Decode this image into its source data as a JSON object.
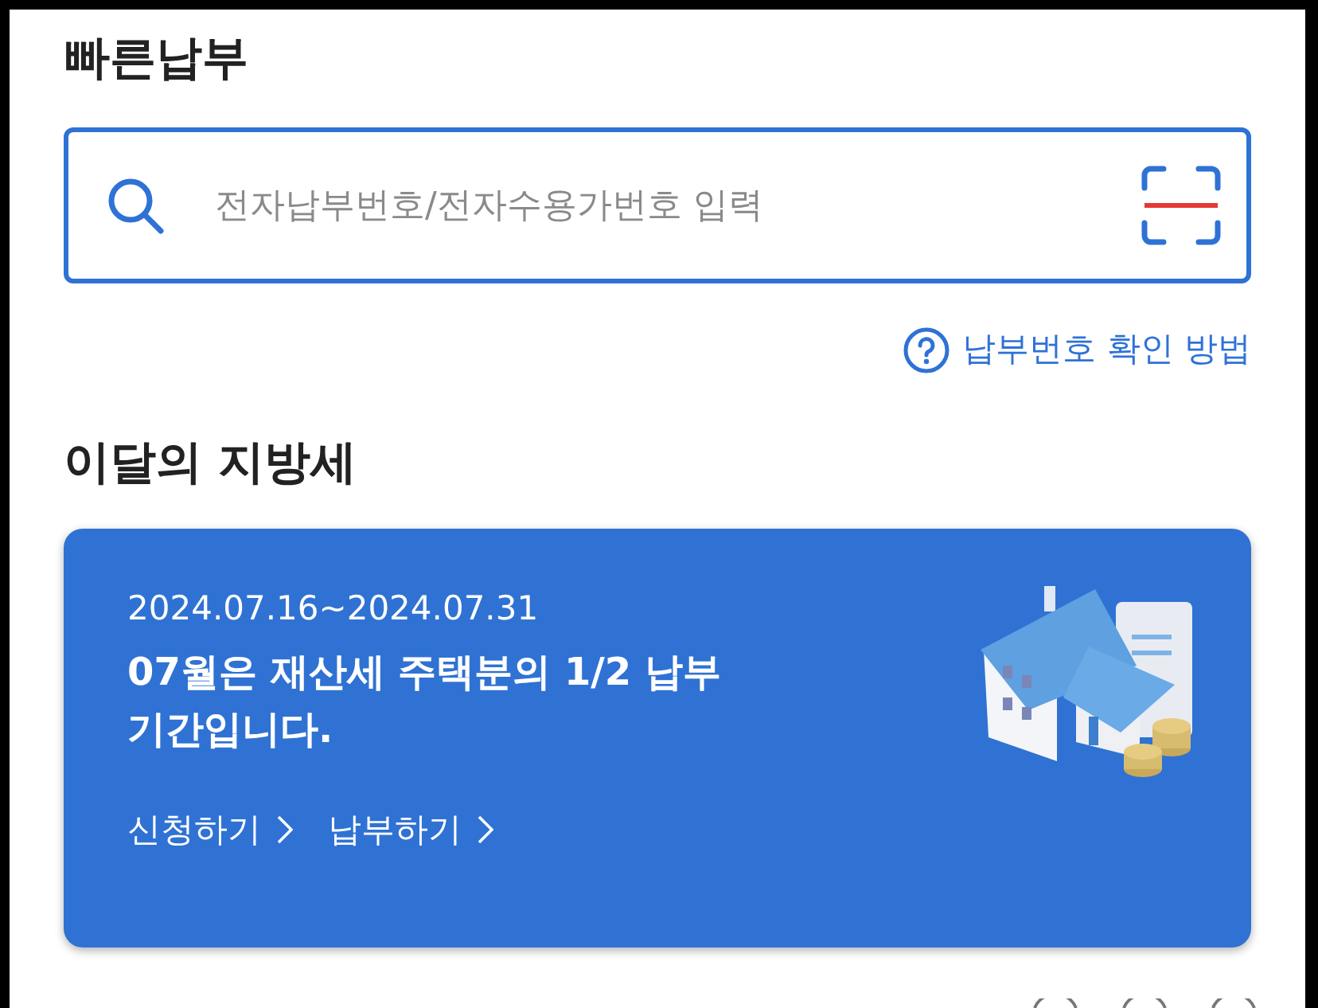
{
  "quick_pay": {
    "title": "빠른납부",
    "search": {
      "placeholder": "전자납부번호/전자수용가번호 입력"
    },
    "help_link": "납부번호 확인 방법"
  },
  "monthly_tax": {
    "title": "이달의 지방세",
    "banner": {
      "period": "2024.07.16~2024.07.31",
      "headline": "07월은 재산세 주택분의 1/2 납부 기간입니다.",
      "links": [
        "신청하기",
        "납부하기"
      ]
    }
  }
}
